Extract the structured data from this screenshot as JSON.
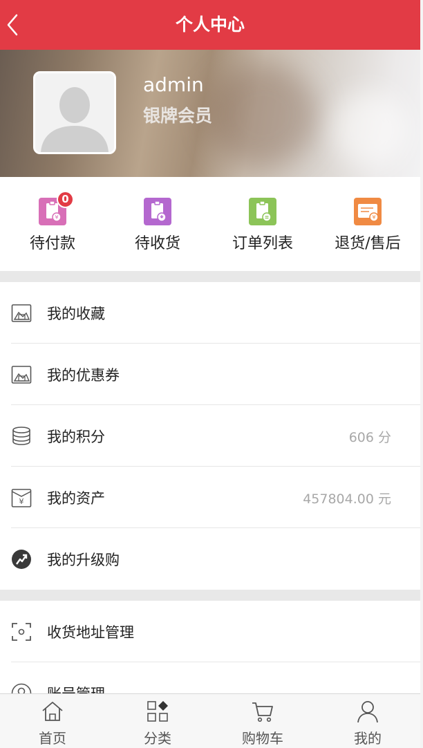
{
  "header": {
    "title": "个人中心"
  },
  "profile": {
    "username": "admin",
    "level": "银牌会员"
  },
  "orders": [
    {
      "label": "待付款",
      "icon": "pending-payment-icon",
      "color": "#d86fb7",
      "badge": "0"
    },
    {
      "label": "待收货",
      "icon": "pending-receipt-icon",
      "color": "#b468cf"
    },
    {
      "label": "订单列表",
      "icon": "order-list-icon",
      "color": "#8cc458"
    },
    {
      "label": "退货/售后",
      "icon": "return-service-icon",
      "color": "#f08a43"
    }
  ],
  "menu1": [
    {
      "label": "我的收藏",
      "icon": "picture-icon"
    },
    {
      "label": "我的优惠券",
      "icon": "picture-icon"
    },
    {
      "label": "我的积分",
      "icon": "coins-stack-icon",
      "value": "606 分"
    },
    {
      "label": "我的资产",
      "icon": "wallet-yen-icon",
      "value": "457804.00 元"
    },
    {
      "label": "我的升级购",
      "icon": "upgrade-icon"
    }
  ],
  "menu2": [
    {
      "label": "收货地址管理",
      "icon": "address-scan-icon"
    },
    {
      "label": "账号管理",
      "icon": "account-icon"
    }
  ],
  "tabbar": [
    {
      "label": "首页",
      "icon": "home-icon"
    },
    {
      "label": "分类",
      "icon": "category-icon"
    },
    {
      "label": "购物车",
      "icon": "cart-icon"
    },
    {
      "label": "我的",
      "icon": "user-icon"
    }
  ]
}
